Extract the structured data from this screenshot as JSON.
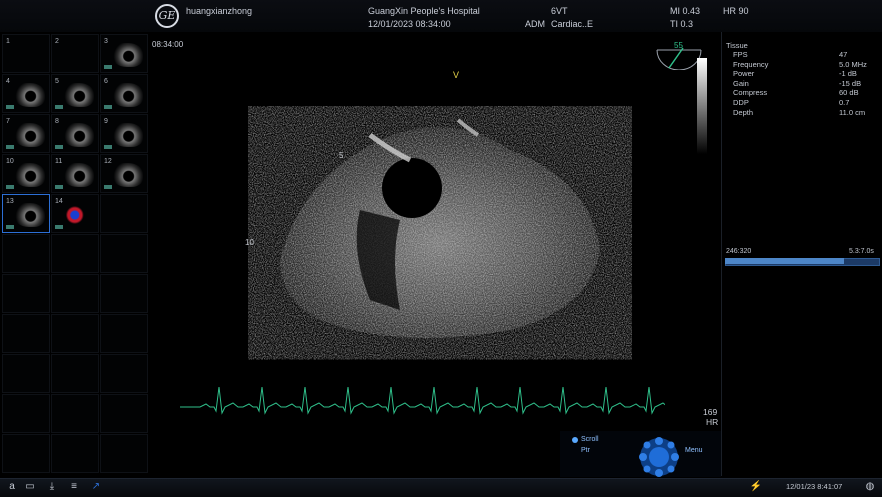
{
  "header": {
    "operator": "huangxianzhong",
    "hospital": "GuangXin People's Hospital",
    "datetime": "12/01/2023 08:34:00",
    "probe": "6VT",
    "user": "ADM",
    "preset": "Cardiac..E",
    "mi": "MI 0.43",
    "hr": "HR 90",
    "ti": "TI 0.3"
  },
  "thumbnails": [
    {
      "num": "1",
      "has_image": false
    },
    {
      "num": "2",
      "has_image": false
    },
    {
      "num": "3",
      "has_image": true
    },
    {
      "num": "4",
      "has_image": true
    },
    {
      "num": "5",
      "has_image": true
    },
    {
      "num": "6",
      "has_image": true
    },
    {
      "num": "7",
      "has_image": true
    },
    {
      "num": "8",
      "has_image": true
    },
    {
      "num": "9",
      "has_image": true
    },
    {
      "num": "10",
      "has_image": true
    },
    {
      "num": "11",
      "has_image": true
    },
    {
      "num": "12",
      "has_image": true
    },
    {
      "num": "13",
      "has_image": true,
      "selected": true
    },
    {
      "num": "14",
      "has_image": true,
      "color": true
    }
  ],
  "image": {
    "timestamp": "08:34:00",
    "orientation_marker": "V",
    "depth_marks": [
      "5",
      "10"
    ],
    "angle": "55",
    "hr_value": "169",
    "hr_label": "HR"
  },
  "params": {
    "mode": "Tissue",
    "rows": [
      {
        "label": "FPS",
        "value": "47"
      },
      {
        "label": "Frequency",
        "value": "5.0 MHz"
      },
      {
        "label": "Power",
        "value": "-1 dB"
      },
      {
        "label": "Gain",
        "value": "-15 dB"
      },
      {
        "label": "Compress",
        "value": "60 dB"
      },
      {
        "label": "DDP",
        "value": "0.7"
      },
      {
        "label": "Depth",
        "value": "11.0 cm"
      }
    ]
  },
  "cine": {
    "frame": "246:320",
    "speed": "5.3:7.0s",
    "progress": 0.77
  },
  "trackball": {
    "scroll": "Scroll",
    "ptr": "Ptr",
    "menu": "Menu"
  },
  "status": {
    "clock": "12/01/23 8:41:07"
  },
  "colors": {
    "ecg": "#2fbf8a",
    "accent_yellow": "#e7d54a",
    "selection_blue": "#2c6fd6"
  }
}
